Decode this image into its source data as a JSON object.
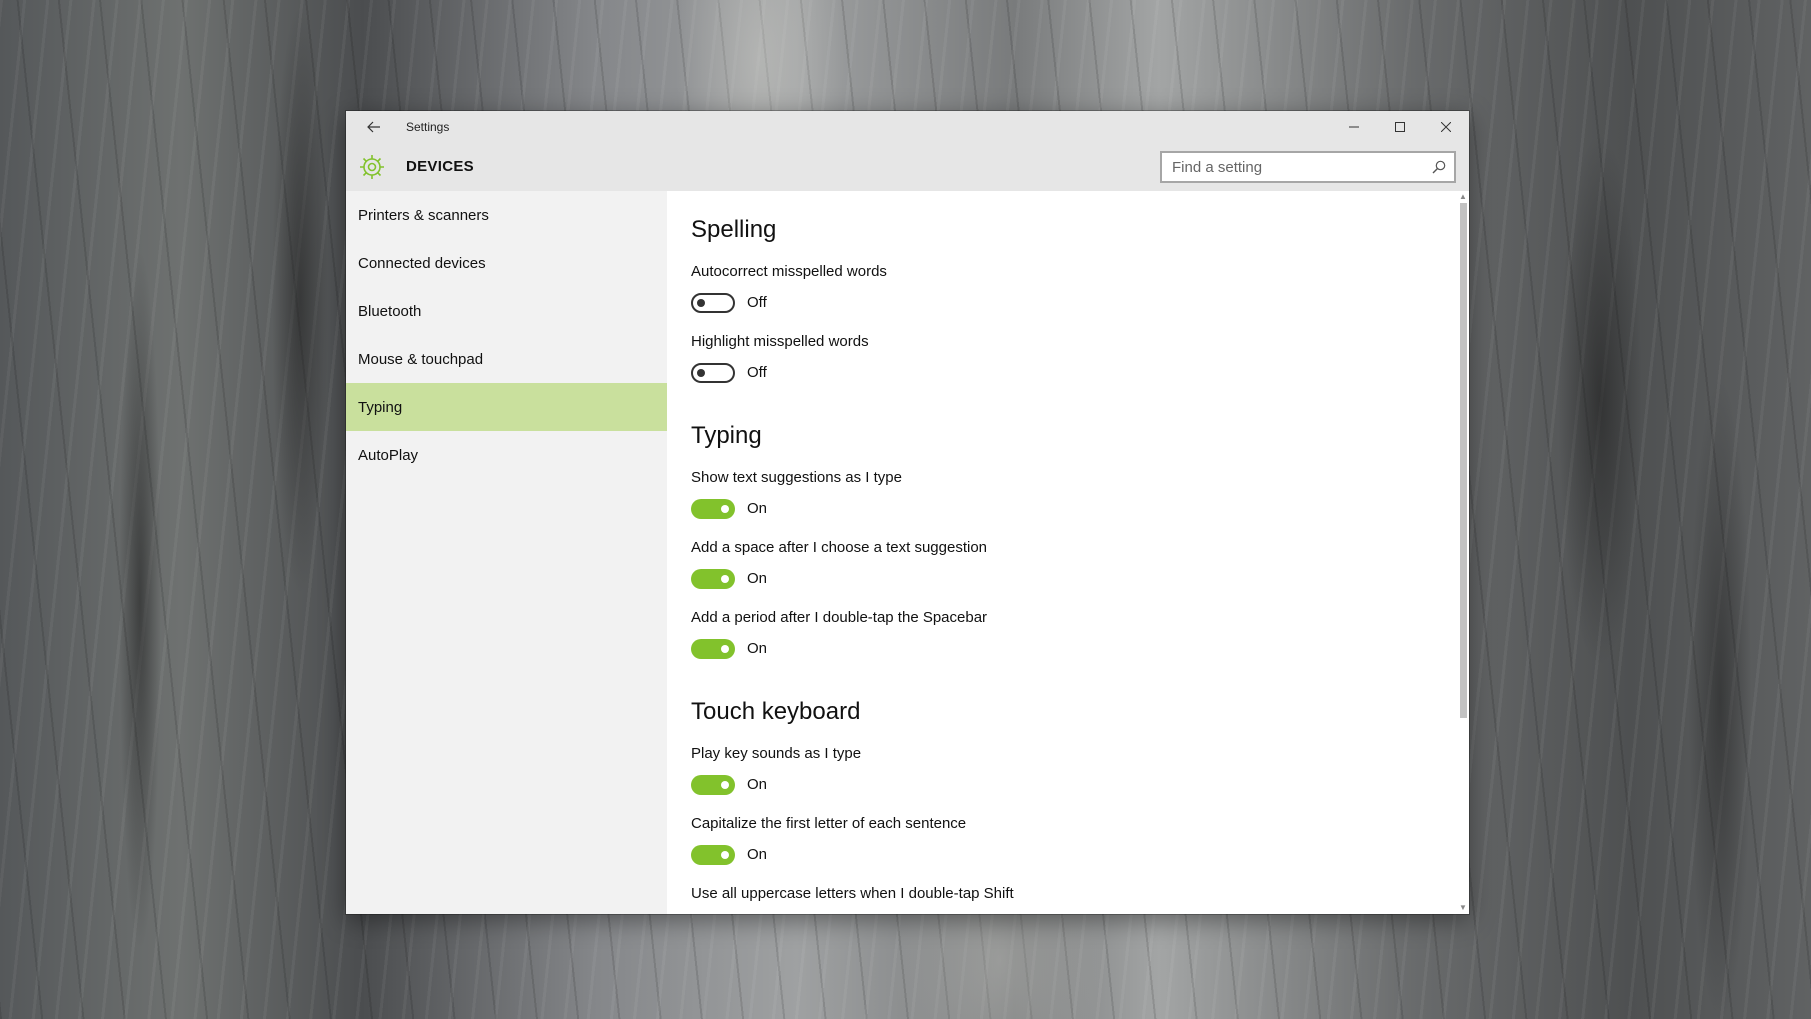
{
  "window": {
    "title": "Settings",
    "section": "DEVICES"
  },
  "search": {
    "placeholder": "Find a setting"
  },
  "sidebar": {
    "items": [
      {
        "label": "Printers & scanners"
      },
      {
        "label": "Connected devices"
      },
      {
        "label": "Bluetooth"
      },
      {
        "label": "Mouse & touchpad"
      },
      {
        "label": "Typing",
        "selected": true
      },
      {
        "label": "AutoPlay"
      }
    ]
  },
  "content": {
    "groups": [
      {
        "title": "Spelling",
        "settings": [
          {
            "label": "Autocorrect misspelled words",
            "state": "Off"
          },
          {
            "label": "Highlight misspelled words",
            "state": "Off"
          }
        ]
      },
      {
        "title": "Typing",
        "settings": [
          {
            "label": "Show text suggestions as I type",
            "state": "On"
          },
          {
            "label": "Add a space after I choose a text suggestion",
            "state": "On"
          },
          {
            "label": "Add a period after I double-tap the Spacebar",
            "state": "On"
          }
        ]
      },
      {
        "title": "Touch keyboard",
        "settings": [
          {
            "label": "Play key sounds as I type",
            "state": "On"
          },
          {
            "label": "Capitalize the first letter of each sentence",
            "state": "On"
          },
          {
            "label": "Use all uppercase letters when I double-tap Shift"
          }
        ]
      }
    ]
  },
  "colors": {
    "accent": "#82c22c",
    "selection": "#c9e09d"
  }
}
